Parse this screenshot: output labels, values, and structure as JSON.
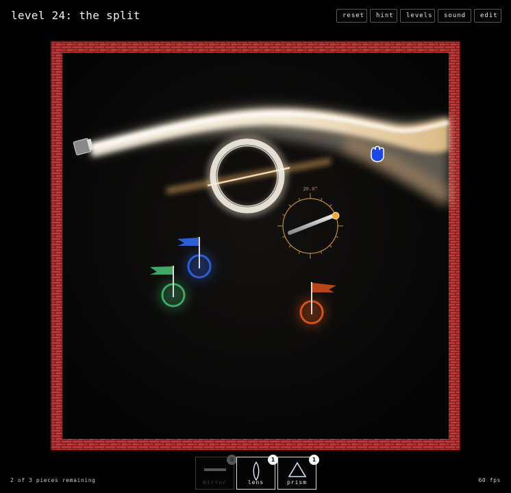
{
  "level_title": "level 24: the split",
  "nav": {
    "reset": "reset",
    "hint": "hint",
    "levels": "levels",
    "sound": "sound",
    "edit": "edit"
  },
  "board": {
    "rotation_readout": "20.0°",
    "wall_color": "#c23a3a",
    "beam_color": "#fff6e6"
  },
  "flags": [
    {
      "color": "#2f5fd8"
    },
    {
      "color": "#3fa866"
    },
    {
      "color": "#d4541c"
    }
  ],
  "tray": [
    {
      "label": "mirror",
      "count": "0"
    },
    {
      "label": "lens",
      "count": "1"
    },
    {
      "label": "prism",
      "count": "1"
    }
  ],
  "status": {
    "pieces_remaining": "2 of 3 pieces remaining",
    "fps": "60 fps"
  },
  "icons": {
    "cursor": "grab-hand-icon",
    "mirror": "mirror-icon",
    "lens": "lens-icon",
    "prism": "prism-icon"
  }
}
